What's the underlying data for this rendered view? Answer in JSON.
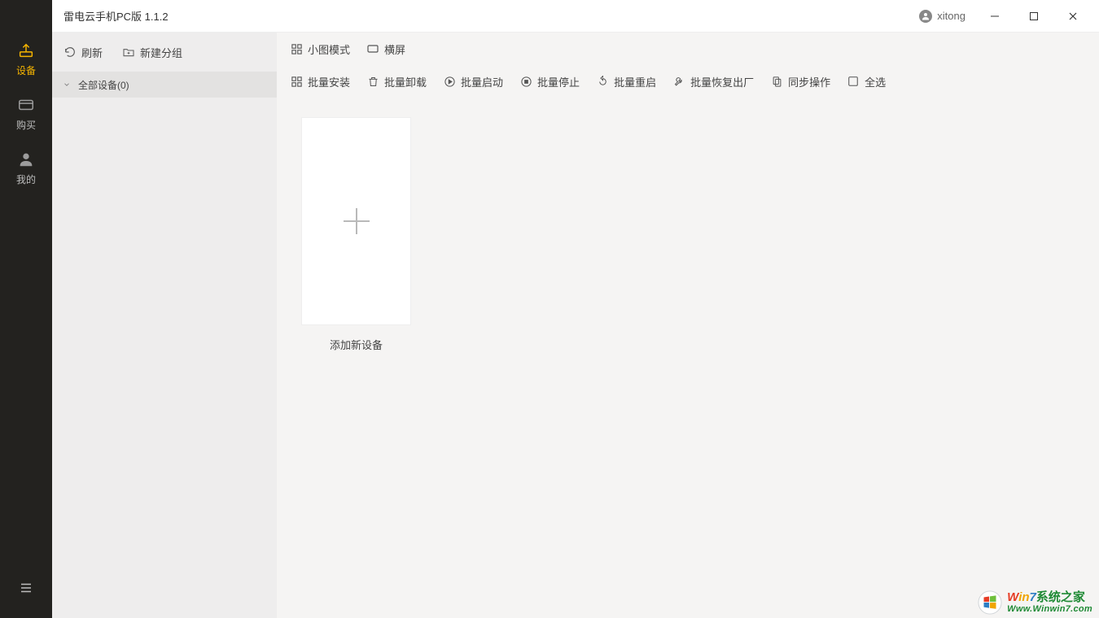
{
  "titlebar": {
    "title": "雷电云手机PC版 1.1.2",
    "username": "xitong"
  },
  "sidebar": {
    "items": [
      {
        "name": "devices",
        "label": "设备",
        "active": true
      },
      {
        "name": "buy",
        "label": "购买",
        "active": false
      },
      {
        "name": "mine",
        "label": "我的",
        "active": false
      }
    ]
  },
  "left_panel": {
    "refresh_label": "刷新",
    "new_group_label": "新建分组",
    "group_row_label": "全部设备(0)"
  },
  "main_panel": {
    "toolbar1": {
      "thumb_mode_label": "小图模式",
      "landscape_label": "横屏"
    },
    "toolbar2": {
      "batch_install_label": "批量安装",
      "batch_uninstall_label": "批量卸载",
      "batch_start_label": "批量启动",
      "batch_stop_label": "批量停止",
      "batch_restart_label": "批量重启",
      "batch_factory_label": "批量恢复出厂",
      "sync_ops_label": "同步操作",
      "select_all_label": "全选"
    },
    "add_card_label": "添加新设备"
  },
  "watermark": {
    "line1_a": "W",
    "line1_b": "i",
    "line1_b2": "n",
    "line1_c": "7",
    "line1_d": "系统之家",
    "line2": "Www.Winwin7.com"
  }
}
